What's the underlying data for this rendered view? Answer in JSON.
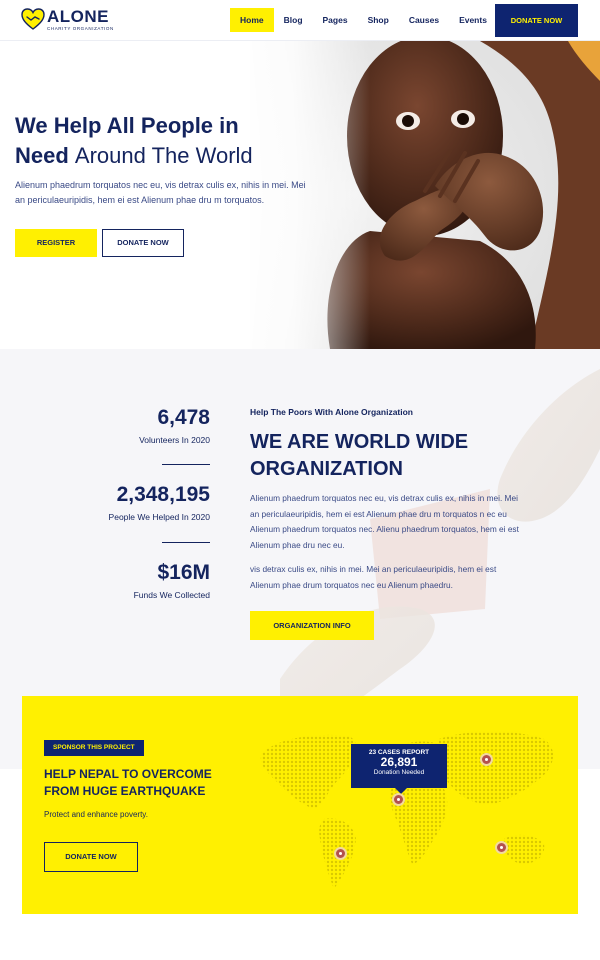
{
  "header": {
    "logo": {
      "name": "ALONE",
      "tagline": "CHARITY ORGANIZATION"
    },
    "nav": [
      "Home",
      "Blog",
      "Pages",
      "Shop",
      "Causes",
      "Events"
    ],
    "active_nav": "Home",
    "donate_label": "DONATE NOW"
  },
  "hero": {
    "title_bold": "We Help All People in",
    "title_bold_2": "Need",
    "title_light": "Around The World",
    "text": "Alienum phaedrum torquatos nec eu, vis detrax culis ex, nihis in mei. Mei an periculaeuripidis, hem ei est Alienum phae dru m torquatos.",
    "register_label": "REGISTER",
    "donate_label": "DONATE NOW"
  },
  "stats": [
    {
      "value": "6,478",
      "label": "Volunteers In 2020"
    },
    {
      "value": "2,348,195",
      "label": "People We Helped In 2020"
    },
    {
      "value": "$16M",
      "label": "Funds We Collected"
    }
  ],
  "about": {
    "kicker": "Help The Poors With Alone Organization",
    "heading": "WE ARE WORLD WIDE ORGANIZATION",
    "p1": "Alienum phaedrum torquatos nec eu, vis detrax culis ex, nihis in mei. Mei an periculaeuripidis, hem ei est Alienum phae dru m torquatos n ec eu Alienum phaedrum torquatos nec. Alienu phaedrum torquatos, hem ei est Alienum phae dru nec eu.",
    "p2": "vis detrax culis ex, nihis in mei. Mei an periculaeuripidis, hem ei est Alienum phae drum torquatos nec eu Alienum phaedru.",
    "button_label": "ORGANIZATION INFO"
  },
  "sponsor": {
    "badge": "SPONSOR THIS PROJECT",
    "title": "HELP NEPAL TO OVERCOME FROM HUGE EARTHQUAKE",
    "text": "Protect and enhance poverty.",
    "button_label": "DONATE NOW",
    "report": {
      "label": "23 CASES REPORT",
      "number": "26,891",
      "sub": "Donation Needed"
    }
  },
  "colors": {
    "navy": "#14245e",
    "yellow": "#fff001",
    "pin": "#b3514e"
  },
  "icons": [
    "heart-hands-logo-icon",
    "map-pin-icon"
  ]
}
